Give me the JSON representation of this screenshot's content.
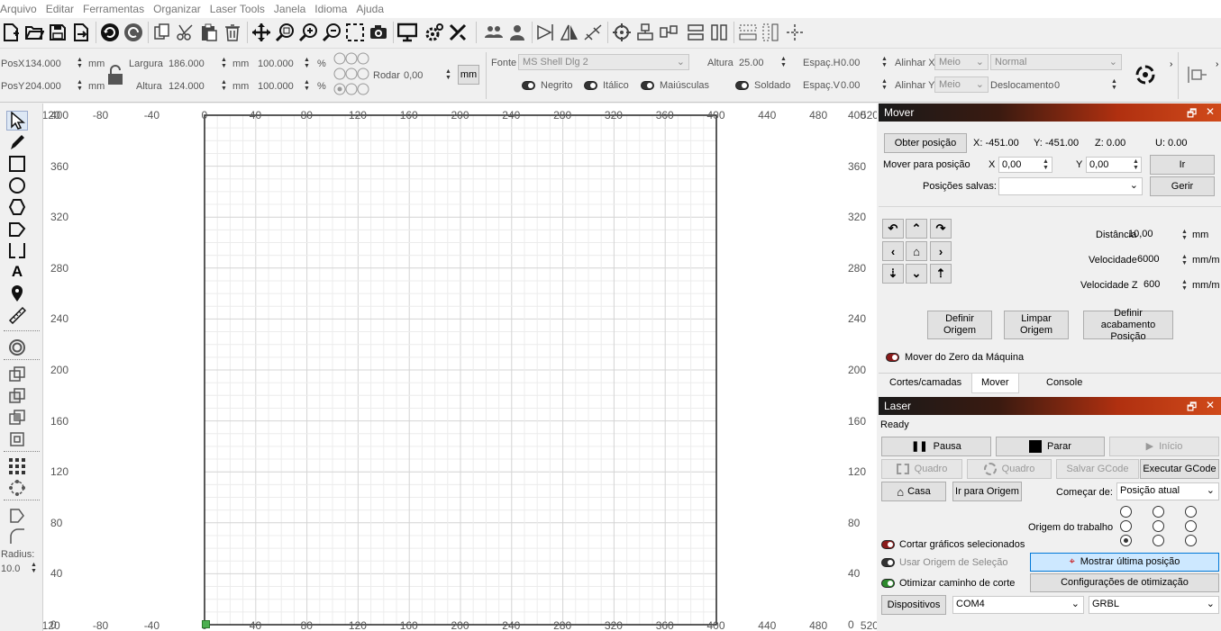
{
  "menu": [
    "Arquivo",
    "Editar",
    "Ferramentas",
    "Organizar",
    "Laser Tools",
    "Janela",
    "Idioma",
    "Ajuda"
  ],
  "props": {
    "posx_label": "PosX",
    "posx": "134.000",
    "posy_label": "PosY",
    "posy": "204.000",
    "unit": "mm",
    "width_label": "Largura",
    "width": "186.000",
    "height_label": "Altura",
    "height": "124.000",
    "wpct": "100.000",
    "hpct": "100.000",
    "pct": "%",
    "rotate_label": "Rodar",
    "rotate": "0,00",
    "mm_btn": "mm",
    "font_label": "Fonte",
    "font": "MS Shell Dlg 2",
    "fheight_label": "Altura",
    "fheight": "25.00",
    "spaceh_label": "Espaç.H",
    "spaceh": "0.00",
    "spacev_label": "Espaç.V",
    "spacev": "0.00",
    "alignx_label": "Alinhar X",
    "alignx": "Meio",
    "aligny_label": "Alinhar Y",
    "aligny": "Meio",
    "style": "Normal",
    "offset_label": "Deslocamento",
    "offset": "0",
    "bold": "Negrito",
    "italic": "Itálico",
    "upper": "Maiúsculas",
    "welded": "Soldado"
  },
  "lefttools": {
    "radius_label": "Radius:",
    "radius": "10.0"
  },
  "ruler": {
    "top": [
      "-120",
      "-80",
      "-40",
      "0",
      "40",
      "80",
      "120",
      "160",
      "200",
      "240",
      "280",
      "320",
      "360",
      "400",
      "440",
      "480",
      "520"
    ],
    "left": [
      "400",
      "360",
      "320",
      "280",
      "240",
      "200",
      "160",
      "120",
      "80",
      "40",
      "0"
    ],
    "right": [
      "400",
      "360",
      "320",
      "280",
      "240",
      "200",
      "160",
      "120",
      "80",
      "40",
      "0"
    ],
    "bottom": [
      "-120",
      "-80",
      "-40",
      "0",
      "40",
      "80",
      "120",
      "160",
      "200",
      "240",
      "280",
      "320",
      "360",
      "400",
      "440",
      "480",
      "520"
    ]
  },
  "move": {
    "title": "Mover",
    "get_pos": "Obter posição",
    "x": "X: -451.00",
    "y": "Y: -451.00",
    "z": "Z: 0.00",
    "u": "U: 0.00",
    "move_to": "Mover para posição",
    "mx_label": "X",
    "mx": "0,00",
    "my_label": "Y",
    "my": "0,00",
    "go": "Ir",
    "saved_label": "Posições salvas:",
    "manage": "Gerir",
    "dist_label": "Distância",
    "dist": "10,00",
    "dist_unit": "mm",
    "speed_label": "Velocidade",
    "speed": "6000",
    "speed_unit": "mm/m",
    "speedz_label": "Velocidade Z",
    "speedz": "600",
    "speedz_unit": "mm/m",
    "set_origin": "Definir Origem",
    "clear_origin": "Limpar Origem",
    "set_finish": "Definir acabamento Posição",
    "from_zero": "Mover do Zero da Máquina"
  },
  "tabs": [
    "Cortes/camadas",
    "Mover",
    "Console"
  ],
  "laser": {
    "title": "Laser",
    "status": "Ready",
    "pause": "Pausa",
    "stop": "Parar",
    "start": "Início",
    "frame1": "Quadro",
    "frame2": "Quadro",
    "save_gcode": "Salvar GCode",
    "run_gcode": "Executar GCode",
    "home": "Casa",
    "goto_origin": "Ir para Origem",
    "start_from_label": "Começar de:",
    "start_from": "Posição atual",
    "job_origin": "Origem do trabalho",
    "cut_selected": "Cortar gráficos selecionados",
    "use_sel_origin": "Usar Origem de Seleção",
    "show_last": "Mostrar última posição",
    "optimize": "Otimizar caminho de corte",
    "opt_settings": "Configurações de otimização",
    "devices": "Dispositivos",
    "port": "COM4",
    "controller": "GRBL"
  }
}
